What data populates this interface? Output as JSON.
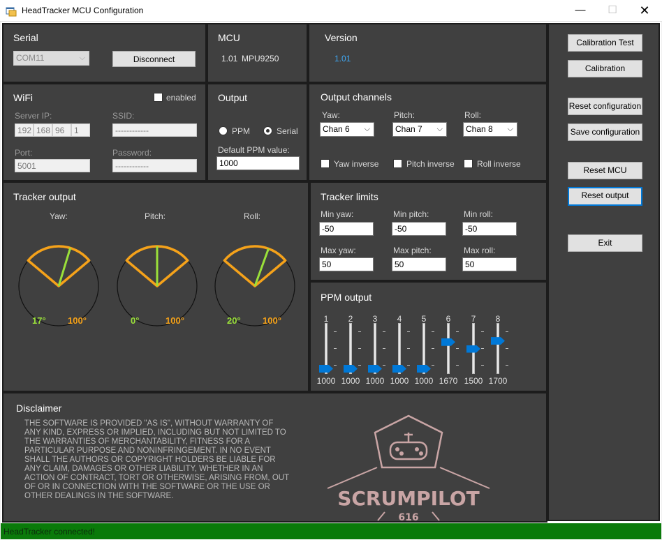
{
  "window": {
    "title": "HeadTracker MCU Configuration",
    "minimize_glyph": "—",
    "maximize_glyph": "☐",
    "close_glyph": "✕"
  },
  "serial": {
    "title": "Serial",
    "port": "COM11",
    "disconnect_label": "Disconnect"
  },
  "mcu": {
    "title": "MCU",
    "version": "1.01",
    "chip": "MPU9250"
  },
  "version": {
    "title": "Version",
    "value": "1.01",
    "value_color": "#3fa9f5"
  },
  "wifi": {
    "title": "WiFi",
    "enabled_label": "enabled",
    "server_ip_label": "Server IP:",
    "ip_octets": [
      "192",
      "168",
      "96",
      "1"
    ],
    "ssid_label": "SSID:",
    "ssid_value": "------------",
    "port_label": "Port:",
    "port_value": "5001",
    "password_label": "Password:",
    "password_value": "------------"
  },
  "output": {
    "title": "Output",
    "ppm_label": "PPM",
    "serial_label": "Serial",
    "selected": "Serial",
    "default_ppm_label": "Default PPM value:",
    "default_ppm_value": "1000"
  },
  "output_channels": {
    "title": "Output channels",
    "yaw_label": "Yaw:",
    "pitch_label": "Pitch:",
    "roll_label": "Roll:",
    "yaw_value": "Chan 6",
    "pitch_value": "Chan 7",
    "roll_value": "Chan 8",
    "yaw_inverse_label": "Yaw inverse",
    "pitch_inverse_label": "Pitch inverse",
    "roll_inverse_label": "Roll inverse"
  },
  "tracker_output": {
    "title": "Tracker output",
    "gauges": [
      {
        "label": "Yaw:",
        "value_text": "17°",
        "range_text": "100°",
        "angle_deg": 17,
        "range_deg": 100
      },
      {
        "label": "Pitch:",
        "value_text": "0°",
        "range_text": "100°",
        "angle_deg": 0,
        "range_deg": 100
      },
      {
        "label": "Roll:",
        "value_text": "20°",
        "range_text": "100°",
        "angle_deg": 20,
        "range_deg": 100
      }
    ],
    "value_color": "#9ae03a",
    "range_color": "#f5a21a"
  },
  "tracker_limits": {
    "title": "Tracker limits",
    "min_yaw_label": "Min yaw:",
    "min_pitch_label": "Min pitch:",
    "min_roll_label": "Min roll:",
    "min_yaw": "-50",
    "min_pitch": "-50",
    "min_roll": "-50",
    "max_yaw_label": "Max yaw:",
    "max_pitch_label": "Max pitch:",
    "max_roll_label": "Max roll:",
    "max_yaw": "50",
    "max_pitch": "50",
    "max_roll": "50"
  },
  "ppm_output": {
    "title": "PPM output",
    "channels": [
      {
        "num": "1",
        "value": "1000",
        "level": 0.0
      },
      {
        "num": "2",
        "value": "1000",
        "level": 0.0
      },
      {
        "num": "3",
        "value": "1000",
        "level": 0.0
      },
      {
        "num": "4",
        "value": "1000",
        "level": 0.0
      },
      {
        "num": "5",
        "value": "1000",
        "level": 0.0
      },
      {
        "num": "6",
        "value": "1670",
        "level": 0.67
      },
      {
        "num": "7",
        "value": "1500",
        "level": 0.5
      },
      {
        "num": "8",
        "value": "1700",
        "level": 0.7
      }
    ],
    "thumb_color": "#0078d7"
  },
  "disclaimer": {
    "title": "Disclaimer",
    "text": "THE SOFTWARE IS PROVIDED \"AS IS\", WITHOUT WARRANTY OF ANY KIND, EXPRESS OR IMPLIED, INCLUDING BUT NOT LIMITED TO THE WARRANTIES OF MERCHANTABILITY, FITNESS FOR A PARTICULAR PURPOSE AND NONINFRINGEMENT. IN NO EVENT SHALL THE AUTHORS OR COPYRIGHT HOLDERS BE LIABLE FOR ANY CLAIM, DAMAGES OR OTHER LIABILITY, WHETHER IN AN ACTION OF CONTRACT, TORT OR OTHERWISE, ARISING FROM, OUT OF OR IN CONNECTION WITH THE SOFTWARE OR THE USE OR OTHER DEALINGS IN THE SOFTWARE.",
    "logo_text": "SCRUMPILOT",
    "logo_number": "616",
    "logo_color": "#c9a5a5"
  },
  "sidebar": {
    "calibration_test": "Calibration Test",
    "calibration": "Calibration",
    "reset_configuration": "Reset configuration",
    "save_configuration": "Save configuration",
    "reset_mcu": "Reset MCU",
    "reset_output": "Reset output",
    "exit": "Exit"
  },
  "status": {
    "text": "HeadTracker connected!"
  }
}
